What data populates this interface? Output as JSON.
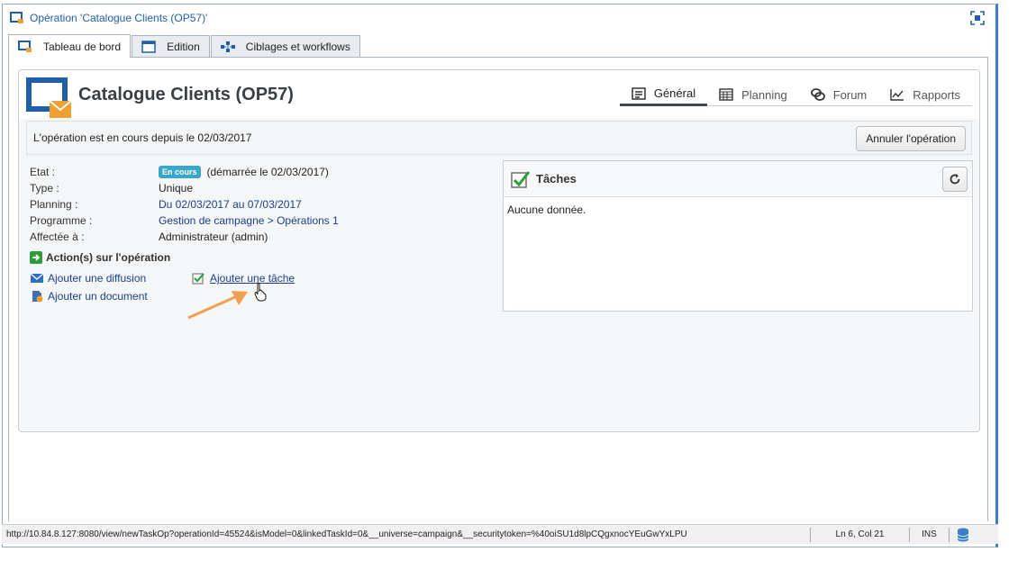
{
  "window": {
    "title": "Opération 'Catalogue Clients (OP57)'"
  },
  "tabs": [
    {
      "label": "Tableau de bord",
      "icon": "dashboard-icon",
      "active": true
    },
    {
      "label": "Edition",
      "icon": "edit-window-icon",
      "active": false
    },
    {
      "label": "Ciblages et workflows",
      "icon": "workflow-icon",
      "active": false
    }
  ],
  "card": {
    "title": "Catalogue Clients (OP57)",
    "subtabs": [
      {
        "label": "Général",
        "icon": "general-icon",
        "active": true
      },
      {
        "label": "Planning",
        "icon": "calendar-icon",
        "active": false
      },
      {
        "label": "Forum",
        "icon": "forum-icon",
        "active": false
      },
      {
        "label": "Rapports",
        "icon": "chart-icon",
        "active": false
      }
    ],
    "banner_text": "L'opération est en cours depuis le 02/03/2017",
    "cancel_label": "Annuler l'opération",
    "info": {
      "etat_label": "Etat :",
      "etat_badge": "En cours",
      "etat_value": "(démarrée le 02/03/2017)",
      "type_label": "Type :",
      "type_value": "Unique",
      "planning_label": "Planning :",
      "planning_value": "Du 02/03/2017 au 07/03/2017",
      "programme_label": "Programme :",
      "programme_value": "Gestion de campagne > Opérations 1",
      "affectee_label": "Affectée à :",
      "affectee_value": "Administrateur (admin)"
    },
    "actions": {
      "title": "Action(s) sur l'opération",
      "add_delivery": "Ajouter une diffusion",
      "add_document": "Ajouter un document",
      "add_task": "Ajouter une tâche"
    },
    "tasks": {
      "title": "Tâches",
      "empty": "Aucune donnée."
    }
  },
  "statusbar": {
    "url": "http://10.84.8.127:8080/view/newTaskOp?operationId=45524&isModel=0&linkedTaskId=0&__universe=campaign&__securitytoken=%40oiSU1d8lpCQgxnocYEuGwYxLPU",
    "position": "Ln 6, Col 21",
    "mode": "INS"
  },
  "colors": {
    "accent": "#1f5fa8",
    "badge": "#3aa6c9",
    "arrow": "#f0a050"
  }
}
